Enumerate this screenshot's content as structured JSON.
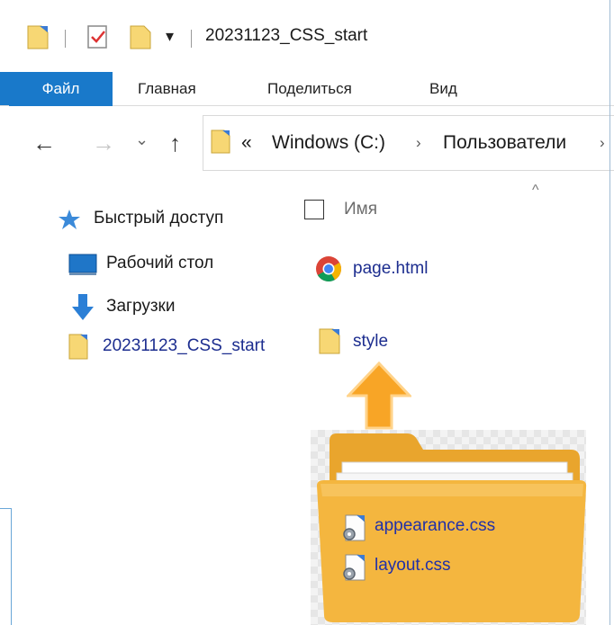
{
  "window": {
    "title": "20231123_CSS_start"
  },
  "quick_access_toolbar": {
    "icons": [
      "folder-icon",
      "properties-check-icon",
      "new-folder-icon",
      "customize-dropdown-icon"
    ],
    "dropdown_glyph": "▾"
  },
  "ribbon": {
    "tabs": [
      {
        "label": "Файл",
        "active": true
      },
      {
        "label": "Главная"
      },
      {
        "label": "Поделиться"
      },
      {
        "label": "Вид"
      }
    ]
  },
  "navigation": {
    "back_glyph": "←",
    "forward_glyph": "→",
    "recent_glyph": "⌄",
    "up_glyph": "↑",
    "address_overflow": "«",
    "breadcrumb": [
      {
        "label": "Windows (C:)"
      },
      {
        "label": "Пользователи"
      }
    ],
    "breadcrumb_separator": "›"
  },
  "nav_pane": {
    "items": [
      {
        "label": "Быстрый доступ",
        "icon": "star-icon"
      },
      {
        "label": "Рабочий стол",
        "icon": "desktop-icon"
      },
      {
        "label": "Загрузки",
        "icon": "download-arrow-icon"
      },
      {
        "label": "20231123_CSS_start",
        "icon": "folder-icon",
        "link": true
      }
    ]
  },
  "file_list": {
    "sort_caret": "^",
    "column_name": "Имя",
    "items": [
      {
        "label": "page.html",
        "icon": "chrome-icon"
      },
      {
        "label": "style",
        "icon": "folder-icon"
      }
    ]
  },
  "callout": {
    "arrow_color": "#f59a1a",
    "folder_color": "#f2b43c",
    "contents": [
      {
        "label": "appearance.css",
        "icon": "css-file-icon"
      },
      {
        "label": "layout.css",
        "icon": "css-file-icon"
      }
    ]
  },
  "colors": {
    "accent": "#1979ca",
    "link": "#1c2d8f",
    "folder": "#f7d774"
  }
}
